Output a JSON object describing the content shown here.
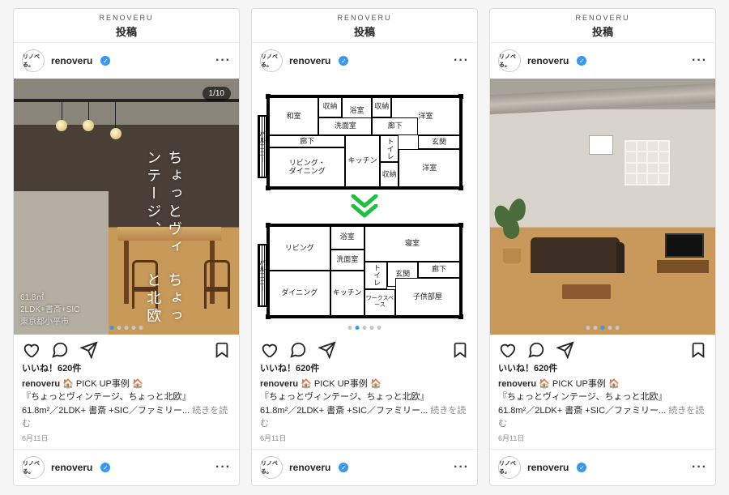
{
  "brand": "RENOVERU",
  "page_title": "投稿",
  "account": {
    "avatar_text": "リノベる。",
    "username": "renoveru",
    "verified_check": "✓"
  },
  "more_glyph": "···",
  "screen1": {
    "page_counter": "1/10",
    "overlay_line1": "ちょっとヴィンテージ、",
    "overlay_line2": "ちょっと北欧",
    "meta_area": "61.8㎡",
    "meta_plan": "2LDK+書斎+SIC",
    "meta_loc": "東京都小平市"
  },
  "screen2": {
    "balcony": "バルコニー",
    "before": {
      "washitsu": "和室",
      "shuno1": "収納",
      "yokushitsu": "浴室",
      "shuno2": "収納",
      "youshitsu1": "洋室",
      "senmen": "洗面室",
      "rouka1": "廊下",
      "rouka2": "廊下",
      "genkan": "玄関",
      "rouka3": "廊下",
      "ld": "リビング・\nダイニング",
      "kitchen": "キッチン",
      "toilet": "トイレ",
      "shuno3": "収納",
      "youshitsu2": "洋室"
    },
    "after": {
      "living": "リビング",
      "yokushitsu": "浴室",
      "shinshitsu": "寝室",
      "senmen": "洗面室",
      "rouka": "廊下",
      "genkan": "玄関",
      "dining": "ダイニング",
      "kitchen": "キッチン",
      "toilet": "トイレ",
      "ws": "ワークスペース",
      "kodomo": "子供部屋"
    }
  },
  "post": {
    "likes": "いいね！620件",
    "username": "renoveru",
    "caption_head": " 🏠 PICK UP事例 🏠",
    "caption_line2": "『ちょっとヴィンテージ、ちょっと北欧』",
    "caption_line3": "61.8m²／2LDK+ 書斎 +SIC／ファミリー... ",
    "more": "続きを読む",
    "date": "6月11日"
  }
}
